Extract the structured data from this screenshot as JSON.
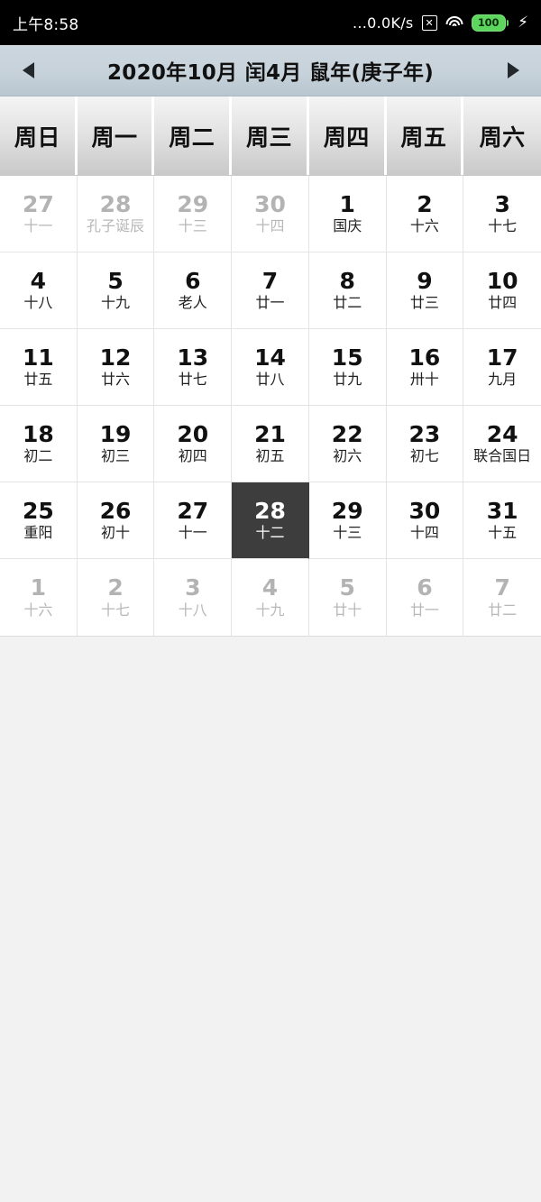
{
  "statusbar": {
    "time": "上午8:58",
    "net_speed": "...0.0K/s",
    "xbox_icon_glyph": "✕",
    "battery_level": "100",
    "icons": [
      "x-box-icon",
      "wifi-icon",
      "battery-icon",
      "charging-bolt-icon"
    ],
    "background": "#000000",
    "battery_color": "#5cd65c"
  },
  "header": {
    "prev_label": "◀",
    "next_label": "▶",
    "title": "2020年10月 闰4月 鼠年(庚子年)",
    "background": "#c7d2da"
  },
  "weekdays": [
    "周日",
    "周一",
    "周二",
    "周三",
    "周四",
    "周五",
    "周六"
  ],
  "calendar": {
    "selected_day": "28",
    "selected_color": "#3d3d3d",
    "weeks": [
      [
        {
          "day": "27",
          "lunar": "十一",
          "other": true
        },
        {
          "day": "28",
          "lunar": "孔子诞辰",
          "other": true
        },
        {
          "day": "29",
          "lunar": "十三",
          "other": true
        },
        {
          "day": "30",
          "lunar": "十四",
          "other": true
        },
        {
          "day": "1",
          "lunar": "国庆",
          "other": false
        },
        {
          "day": "2",
          "lunar": "十六",
          "other": false
        },
        {
          "day": "3",
          "lunar": "十七",
          "other": false
        }
      ],
      [
        {
          "day": "4",
          "lunar": "十八",
          "other": false
        },
        {
          "day": "5",
          "lunar": "十九",
          "other": false
        },
        {
          "day": "6",
          "lunar": "老人",
          "other": false
        },
        {
          "day": "7",
          "lunar": "廿一",
          "other": false
        },
        {
          "day": "8",
          "lunar": "廿二",
          "other": false
        },
        {
          "day": "9",
          "lunar": "廿三",
          "other": false
        },
        {
          "day": "10",
          "lunar": "廿四",
          "other": false
        }
      ],
      [
        {
          "day": "11",
          "lunar": "廿五",
          "other": false
        },
        {
          "day": "12",
          "lunar": "廿六",
          "other": false
        },
        {
          "day": "13",
          "lunar": "廿七",
          "other": false
        },
        {
          "day": "14",
          "lunar": "廿八",
          "other": false
        },
        {
          "day": "15",
          "lunar": "廿九",
          "other": false
        },
        {
          "day": "16",
          "lunar": "卅十",
          "other": false
        },
        {
          "day": "17",
          "lunar": "九月",
          "other": false
        }
      ],
      [
        {
          "day": "18",
          "lunar": "初二",
          "other": false
        },
        {
          "day": "19",
          "lunar": "初三",
          "other": false
        },
        {
          "day": "20",
          "lunar": "初四",
          "other": false
        },
        {
          "day": "21",
          "lunar": "初五",
          "other": false
        },
        {
          "day": "22",
          "lunar": "初六",
          "other": false
        },
        {
          "day": "23",
          "lunar": "初七",
          "other": false
        },
        {
          "day": "24",
          "lunar": "联合国日",
          "other": false
        }
      ],
      [
        {
          "day": "25",
          "lunar": "重阳",
          "other": false
        },
        {
          "day": "26",
          "lunar": "初十",
          "other": false
        },
        {
          "day": "27",
          "lunar": "十一",
          "other": false
        },
        {
          "day": "28",
          "lunar": "十二",
          "other": false,
          "selected": true
        },
        {
          "day": "29",
          "lunar": "十三",
          "other": false
        },
        {
          "day": "30",
          "lunar": "十四",
          "other": false
        },
        {
          "day": "31",
          "lunar": "十五",
          "other": false
        }
      ],
      [
        {
          "day": "1",
          "lunar": "十六",
          "other": true
        },
        {
          "day": "2",
          "lunar": "十七",
          "other": true
        },
        {
          "day": "3",
          "lunar": "十八",
          "other": true
        },
        {
          "day": "4",
          "lunar": "十九",
          "other": true
        },
        {
          "day": "5",
          "lunar": "廿十",
          "other": true
        },
        {
          "day": "6",
          "lunar": "廿一",
          "other": true
        },
        {
          "day": "7",
          "lunar": "廿二",
          "other": true
        }
      ]
    ]
  }
}
